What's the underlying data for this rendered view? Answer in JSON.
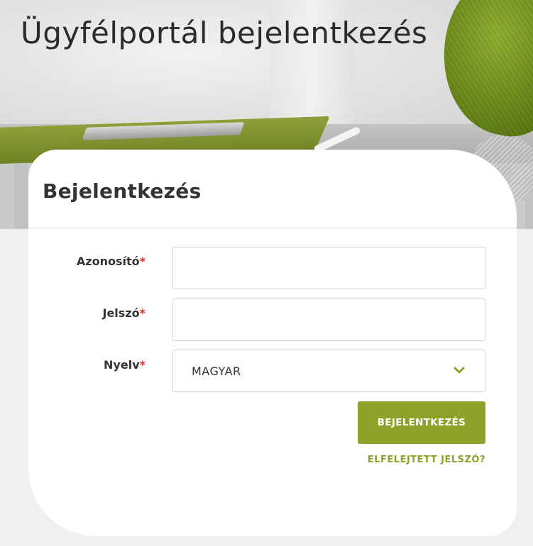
{
  "page": {
    "title": "Ügyfélportál bejelentkezés"
  },
  "login_card": {
    "title": "Bejelentkezés",
    "fields": [
      {
        "label": "Azonosító",
        "required_marker": "*",
        "value": "",
        "placeholder": ""
      },
      {
        "label": "Jelszó",
        "required_marker": "*",
        "value": "",
        "placeholder": ""
      },
      {
        "label": "Nyelv",
        "required_marker": "*",
        "selected": "MAGYAR",
        "icon": "chevron-down-icon"
      }
    ],
    "submit_label": "BEJELENTKEZÉS",
    "forgot_password_label": "ELFELEJTETT JELSZÓ?"
  },
  "colors": {
    "accent": "#8fa129",
    "required": "#d0362c",
    "text": "#333333",
    "background": "#f0f0f0"
  }
}
